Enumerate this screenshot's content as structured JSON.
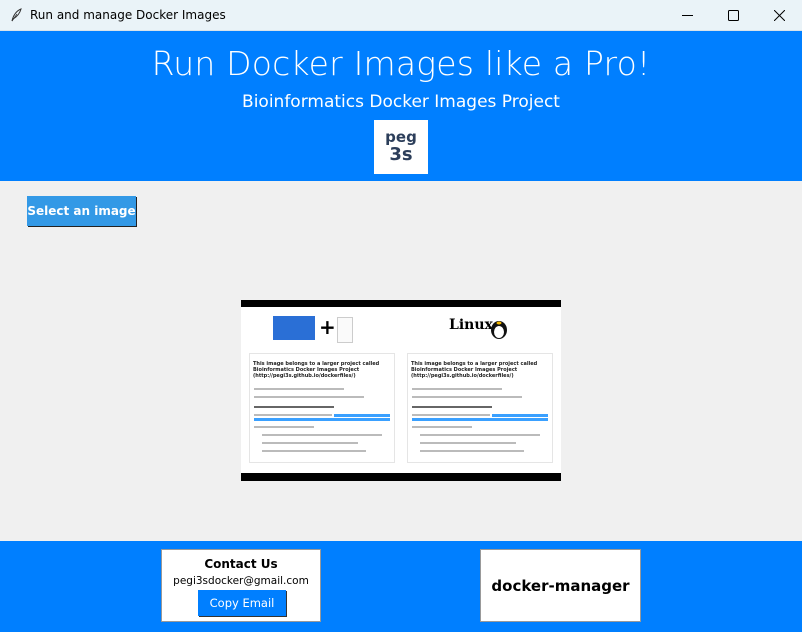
{
  "window": {
    "title": "Run and manage Docker Images",
    "minimize_icon": "minimize-icon",
    "maximize_icon": "maximize-icon",
    "close_icon": "close-icon"
  },
  "header": {
    "title": "Run Docker Images like a Pro!",
    "subtitle": "Bioinformatics Docker Images Project",
    "logo_line1": "peg",
    "logo_line2": "3s"
  },
  "actions": {
    "select_image_label": "Select an image"
  },
  "preview": {
    "plus_symbol": "+",
    "linux_label": "Linux",
    "panels": [
      {
        "heading": "This image belongs to a larger project called Bioinformatics Docker Images Project (http://pegi3s.github.io/dockerfiles/)"
      },
      {
        "heading": "This image belongs to a larger project called Bioinformatics Docker Images Project (http://pegi3s.github.io/dockerfiles/)"
      }
    ]
  },
  "footer": {
    "contact_title": "Contact Us",
    "contact_email": "pegi3sdocker@gmail.com",
    "copy_email_label": "Copy Email",
    "docker_manager_label": "docker-manager"
  },
  "colors": {
    "brand_blue": "#007fff",
    "button_blue": "#3399e6",
    "background": "#f0f0f0"
  }
}
